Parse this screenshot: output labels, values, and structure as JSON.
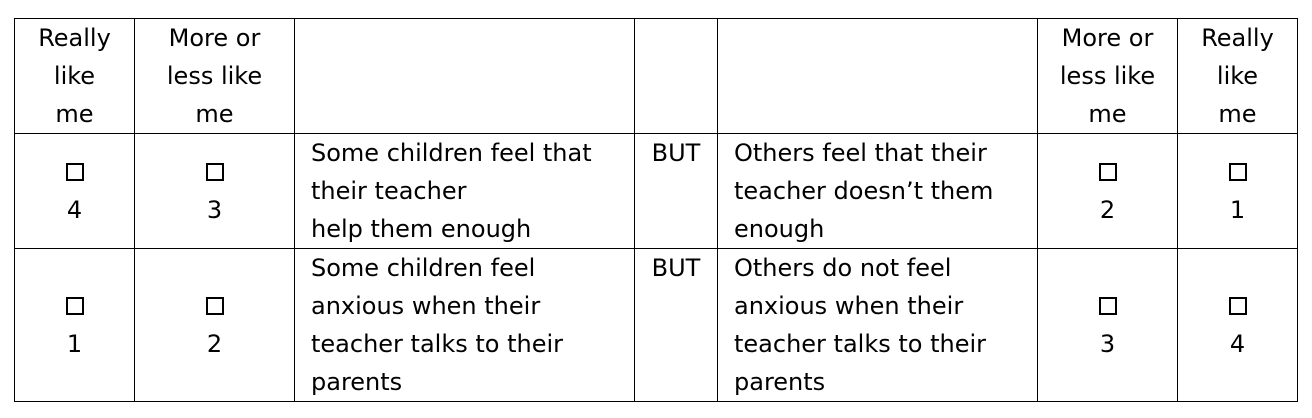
{
  "header": {
    "col1": [
      "Really",
      "like",
      "me"
    ],
    "col2": [
      "More or",
      "less like",
      "me"
    ],
    "col6": [
      "More or",
      "less like",
      "me"
    ],
    "col7": [
      "Really",
      "like",
      "me"
    ]
  },
  "rows": [
    {
      "left_text": [
        "Some children feel that",
        "their teacher",
        "help them enough"
      ],
      "connector": "BUT",
      "right_text": [
        "Others feel that their",
        "teacher doesn’t them",
        "enough"
      ],
      "scores": [
        "4",
        "3",
        "2",
        "1"
      ]
    },
    {
      "left_text": [
        "Some children feel",
        "anxious when their",
        "teacher talks to their",
        "parents"
      ],
      "connector": "BUT",
      "right_text": [
        "Others do not feel",
        "anxious when their",
        "teacher talks to their",
        "parents"
      ],
      "scores": [
        "1",
        "2",
        "3",
        "4"
      ]
    }
  ]
}
